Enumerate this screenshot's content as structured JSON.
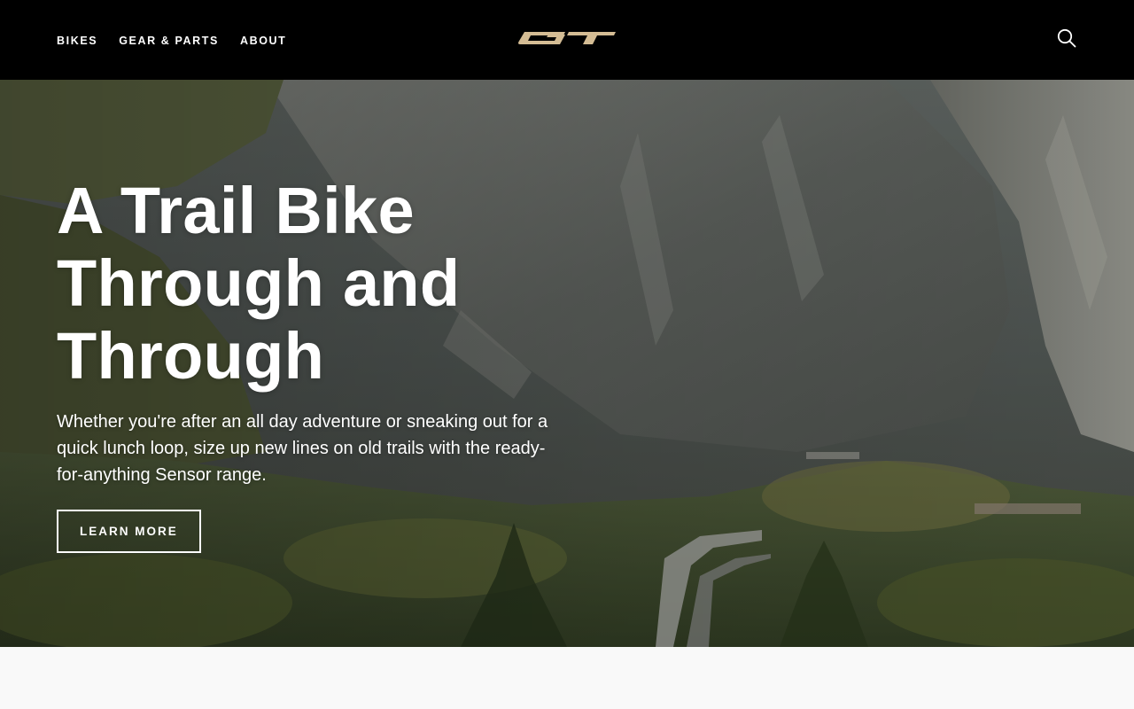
{
  "header": {
    "nav": [
      {
        "label": "BIKES"
      },
      {
        "label": "GEAR & PARTS"
      },
      {
        "label": "ABOUT"
      }
    ],
    "logo_text": "GT",
    "logo_color": "#d4bc94",
    "search_icon": "search-icon"
  },
  "hero": {
    "title_lines": [
      "A Trail Bike",
      "Through and",
      "Through"
    ],
    "description": "Whether you're after an all day adventure or sneaking out for a quick lunch loop, size up new lines on old trails with the ready-for-anything Sensor range.",
    "cta_label": "LEARN MORE"
  },
  "colors": {
    "header_bg": "#000000",
    "text": "#ffffff",
    "page_bg": "#f9f9f9"
  }
}
